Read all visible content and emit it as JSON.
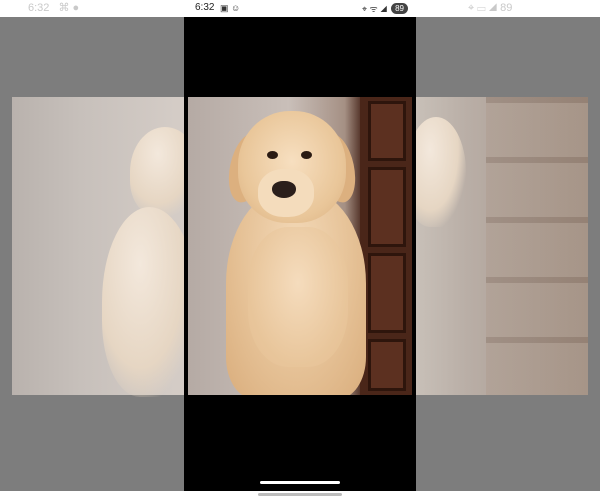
{
  "status_bar": {
    "time": "6:32",
    "battery": "89",
    "left_icons": "▣ ☺",
    "right_icons": "⌖ ᯤ ◢"
  },
  "background_status": {
    "left_time": "6:32",
    "left_icons": "⌘ ●",
    "right_icons": "⌖ ▭ ◢ 89"
  },
  "photo": {
    "subject": "golden-retriever-photo"
  },
  "colors": {
    "frame": "#000000",
    "side_overlay": "#7d7d7d",
    "door": "#4a2619"
  }
}
